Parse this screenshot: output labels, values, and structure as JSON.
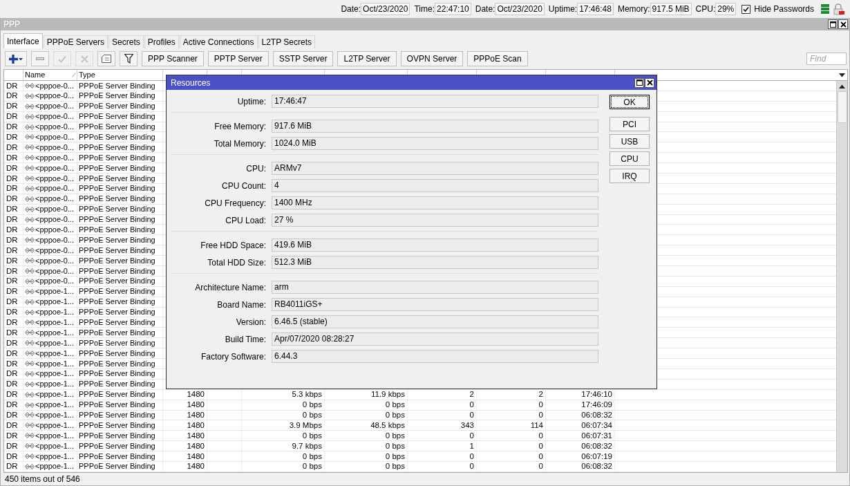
{
  "top_bar": {
    "fields": [
      {
        "label": "Date:",
        "value": "Oct/23/2020"
      },
      {
        "label": "Time:",
        "value": "22:47:10"
      },
      {
        "label": "Date:",
        "value": "Oct/23/2020"
      },
      {
        "label": "Uptime:",
        "value": "17:46:48"
      },
      {
        "label": "Memory:",
        "value": "917.5 MiB"
      },
      {
        "label": "CPU:",
        "value": "29%"
      }
    ],
    "hide_passwords": {
      "label": "Hide Passwords",
      "checked": true
    }
  },
  "window": {
    "title": "PPP"
  },
  "tabs": [
    {
      "label": "Interface",
      "selected": true
    },
    {
      "label": "PPPoE Servers",
      "selected": false
    },
    {
      "label": "Secrets",
      "selected": false
    },
    {
      "label": "Profiles",
      "selected": false
    },
    {
      "label": "Active Connections",
      "selected": false
    },
    {
      "label": "L2TP Secrets",
      "selected": false
    }
  ],
  "toolbar": {
    "icon_buttons": [
      {
        "kind": "add",
        "disabled": false
      },
      {
        "kind": "remove",
        "disabled": false
      },
      {
        "kind": "enable",
        "disabled": true
      },
      {
        "kind": "disable",
        "disabled": true
      },
      {
        "kind": "comment",
        "disabled": false
      },
      {
        "kind": "filter",
        "disabled": false
      }
    ],
    "buttons": [
      "PPP Scanner",
      "PPTP Server",
      "SSTP Server",
      "L2TP Server",
      "OVPN Server",
      "PPPoE Scan"
    ],
    "find": {
      "placeholder": "Find"
    }
  },
  "table": {
    "columns": [
      "Name",
      "Type"
    ],
    "rows": [
      {
        "flags": "DR",
        "name": "<pppoe-0...",
        "type": "PPPoE Server Binding"
      },
      {
        "flags": "DR",
        "name": "<pppoe-0...",
        "type": "PPPoE Server Binding"
      },
      {
        "flags": "DR",
        "name": "<pppoe-0...",
        "type": "PPPoE Server Binding"
      },
      {
        "flags": "DR",
        "name": "<pppoe-0...",
        "type": "PPPoE Server Binding"
      },
      {
        "flags": "DR",
        "name": "<pppoe-0...",
        "type": "PPPoE Server Binding"
      },
      {
        "flags": "DR",
        "name": "<pppoe-0...",
        "type": "PPPoE Server Binding"
      },
      {
        "flags": "DR",
        "name": "<pppoe-0...",
        "type": "PPPoE Server Binding"
      },
      {
        "flags": "DR",
        "name": "<pppoe-0...",
        "type": "PPPoE Server Binding"
      },
      {
        "flags": "DR",
        "name": "<pppoe-0...",
        "type": "PPPoE Server Binding"
      },
      {
        "flags": "DR",
        "name": "<pppoe-0...",
        "type": "PPPoE Server Binding"
      },
      {
        "flags": "DR",
        "name": "<pppoe-0...",
        "type": "PPPoE Server Binding"
      },
      {
        "flags": "DR",
        "name": "<pppoe-0...",
        "type": "PPPoE Server Binding"
      },
      {
        "flags": "DR",
        "name": "<pppoe-0...",
        "type": "PPPoE Server Binding"
      },
      {
        "flags": "DR",
        "name": "<pppoe-0...",
        "type": "PPPoE Server Binding"
      },
      {
        "flags": "DR",
        "name": "<pppoe-0...",
        "type": "PPPoE Server Binding"
      },
      {
        "flags": "DR",
        "name": "<pppoe-0...",
        "type": "PPPoE Server Binding"
      },
      {
        "flags": "DR",
        "name": "<pppoe-0...",
        "type": "PPPoE Server Binding"
      },
      {
        "flags": "DR",
        "name": "<pppoe-0...",
        "type": "PPPoE Server Binding"
      },
      {
        "flags": "DR",
        "name": "<pppoe-0...",
        "type": "PPPoE Server Binding"
      },
      {
        "flags": "DR",
        "name": "<pppoe-0...",
        "type": "PPPoE Server Binding"
      },
      {
        "flags": "DR",
        "name": "<pppoe-1...",
        "type": "PPPoE Server Binding"
      },
      {
        "flags": "DR",
        "name": "<pppoe-1...",
        "type": "PPPoE Server Binding"
      },
      {
        "flags": "DR",
        "name": "<pppoe-1...",
        "type": "PPPoE Server Binding"
      },
      {
        "flags": "DR",
        "name": "<pppoe-1...",
        "type": "PPPoE Server Binding"
      },
      {
        "flags": "DR",
        "name": "<pppoe-1...",
        "type": "PPPoE Server Binding"
      },
      {
        "flags": "DR",
        "name": "<pppoe-1...",
        "type": "PPPoE Server Binding"
      },
      {
        "flags": "DR",
        "name": "<pppoe-1...",
        "type": "PPPoE Server Binding"
      },
      {
        "flags": "DR",
        "name": "<pppoe-1...",
        "type": "PPPoE Server Binding"
      },
      {
        "flags": "DR",
        "name": "<pppoe-1...",
        "type": "PPPoE Server Binding"
      },
      {
        "flags": "DR",
        "name": "<pppoe-1...",
        "type": "PPPoE Server Binding"
      },
      {
        "flags": "DR",
        "name": "<pppoe-1...",
        "type": "PPPoE Server Binding",
        "actual_mtu": "1480",
        "tx": "5.3 kbps",
        "rx": "11.9 kbps",
        "tx_packets": "2",
        "rx_packets": "2",
        "uptime": "17:46:10"
      },
      {
        "flags": "DR",
        "name": "<pppoe-1...",
        "type": "PPPoE Server Binding",
        "actual_mtu": "1480",
        "tx": "0 bps",
        "rx": "0 bps",
        "tx_packets": "0",
        "rx_packets": "0",
        "uptime": "17:46:09"
      },
      {
        "flags": "DR",
        "name": "<pppoe-1...",
        "type": "PPPoE Server Binding",
        "actual_mtu": "1480",
        "tx": "0 bps",
        "rx": "0 bps",
        "tx_packets": "0",
        "rx_packets": "0",
        "uptime": "06:08:32"
      },
      {
        "flags": "DR",
        "name": "<pppoe-1...",
        "type": "PPPoE Server Binding",
        "actual_mtu": "1480",
        "tx": "3.9 Mbps",
        "rx": "48.5 kbps",
        "tx_packets": "343",
        "rx_packets": "114",
        "uptime": "06:07:34"
      },
      {
        "flags": "DR",
        "name": "<pppoe-1...",
        "type": "PPPoE Server Binding",
        "actual_mtu": "1480",
        "tx": "0 bps",
        "rx": "0 bps",
        "tx_packets": "0",
        "rx_packets": "0",
        "uptime": "06:07:31"
      },
      {
        "flags": "DR",
        "name": "<pppoe-1...",
        "type": "PPPoE Server Binding",
        "actual_mtu": "1480",
        "tx": "9.7 kbps",
        "rx": "0 bps",
        "tx_packets": "1",
        "rx_packets": "0",
        "uptime": "06:08:32"
      },
      {
        "flags": "DR",
        "name": "<pppoe-1...",
        "type": "PPPoE Server Binding",
        "actual_mtu": "1480",
        "tx": "0 bps",
        "rx": "0 bps",
        "tx_packets": "0",
        "rx_packets": "0",
        "uptime": "06:07:19"
      },
      {
        "flags": "DR",
        "name": "<pppoe-1...",
        "type": "PPPoE Server Binding",
        "actual_mtu": "1480",
        "tx": "0 bps",
        "rx": "0 bps",
        "tx_packets": "0",
        "rx_packets": "0",
        "uptime": "06:08:32"
      }
    ]
  },
  "status_bar": "450 items out of 546",
  "dialog": {
    "title": "Resources",
    "groups": [
      [
        {
          "label": "Uptime:",
          "value": "17:46:47"
        }
      ],
      [
        {
          "label": "Free Memory:",
          "value": "917.6 MiB"
        },
        {
          "label": "Total Memory:",
          "value": "1024.0 MiB"
        }
      ],
      [
        {
          "label": "CPU:",
          "value": "ARMv7"
        },
        {
          "label": "CPU Count:",
          "value": "4"
        },
        {
          "label": "CPU Frequency:",
          "value": "1400 MHz"
        },
        {
          "label": "CPU Load:",
          "value": "27 %"
        }
      ],
      [
        {
          "label": "Free HDD Space:",
          "value": "419.6 MiB"
        },
        {
          "label": "Total HDD Size:",
          "value": "512.3 MiB"
        }
      ],
      [
        {
          "label": "Architecture Name:",
          "value": "arm"
        },
        {
          "label": "Board Name:",
          "value": "RB4011iGS+"
        },
        {
          "label": "Version:",
          "value": "6.46.5 (stable)"
        },
        {
          "label": "Build Time:",
          "value": "Apr/07/2020 08:28:27"
        },
        {
          "label": "Factory Software:",
          "value": "6.44.3"
        }
      ]
    ],
    "buttons": [
      {
        "label": "OK",
        "focused": true
      },
      {
        "label": "PCI",
        "focused": false
      },
      {
        "label": "USB",
        "focused": false
      },
      {
        "label": "CPU",
        "focused": false
      },
      {
        "label": "IRQ",
        "focused": false
      }
    ]
  }
}
